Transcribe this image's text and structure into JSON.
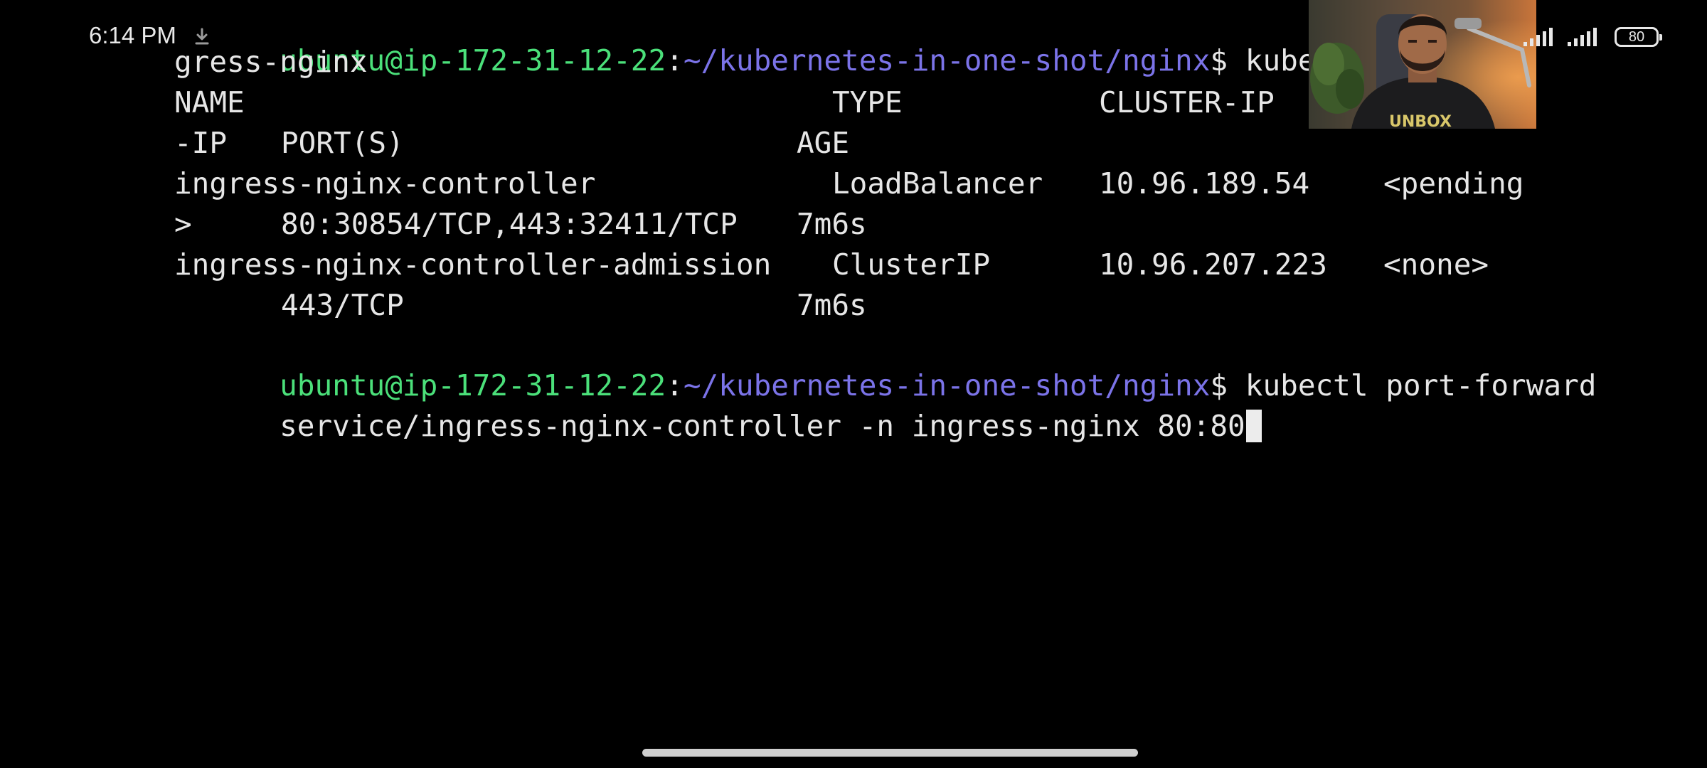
{
  "status_bar": {
    "time": "6:14 PM",
    "battery_level": "80",
    "icons": [
      "download-icon",
      "signal-icon",
      "signal-icon",
      "battery-icon"
    ]
  },
  "terminal": {
    "prompt_user": "ubuntu@ip-172-31-12-22",
    "prompt_sep": ":",
    "prompt_path": "~/kubernetes-in-one-shot/nginx",
    "prompt_dollar": "$",
    "first_command": " kubectl g",
    "first_command_wrap": "gress-nginx",
    "table": {
      "headers_line1": [
        "NAME",
        "TYPE",
        "CLUSTER-IP"
      ],
      "headers_line2": [
        "-IP",
        "PORT(S)",
        "AGE"
      ],
      "rows": [
        {
          "name": "ingress-nginx-controller",
          "type": "LoadBalancer",
          "cluster_ip": "10.96.189.54",
          "external_ip": "<pending",
          "external_ip_wrap": ">",
          "ports": "80:30854/TCP,443:32411/TCP",
          "age": "7m6s"
        },
        {
          "name": "ingress-nginx-controller-admission",
          "type": "ClusterIP",
          "cluster_ip": "10.96.207.223",
          "external_ip": "<none>",
          "external_ip_wrap": "",
          "ports": "443/TCP",
          "age": "7m6s"
        }
      ]
    },
    "second_command": " kubectl port-forward",
    "second_command_wrap": "service/ingress-nginx-controller -n ingress-nginx 80:80"
  },
  "colors": {
    "background": "#000000",
    "prompt_user": "#4be07a",
    "prompt_path": "#7b73e8",
    "text": "#e6e6e6"
  }
}
